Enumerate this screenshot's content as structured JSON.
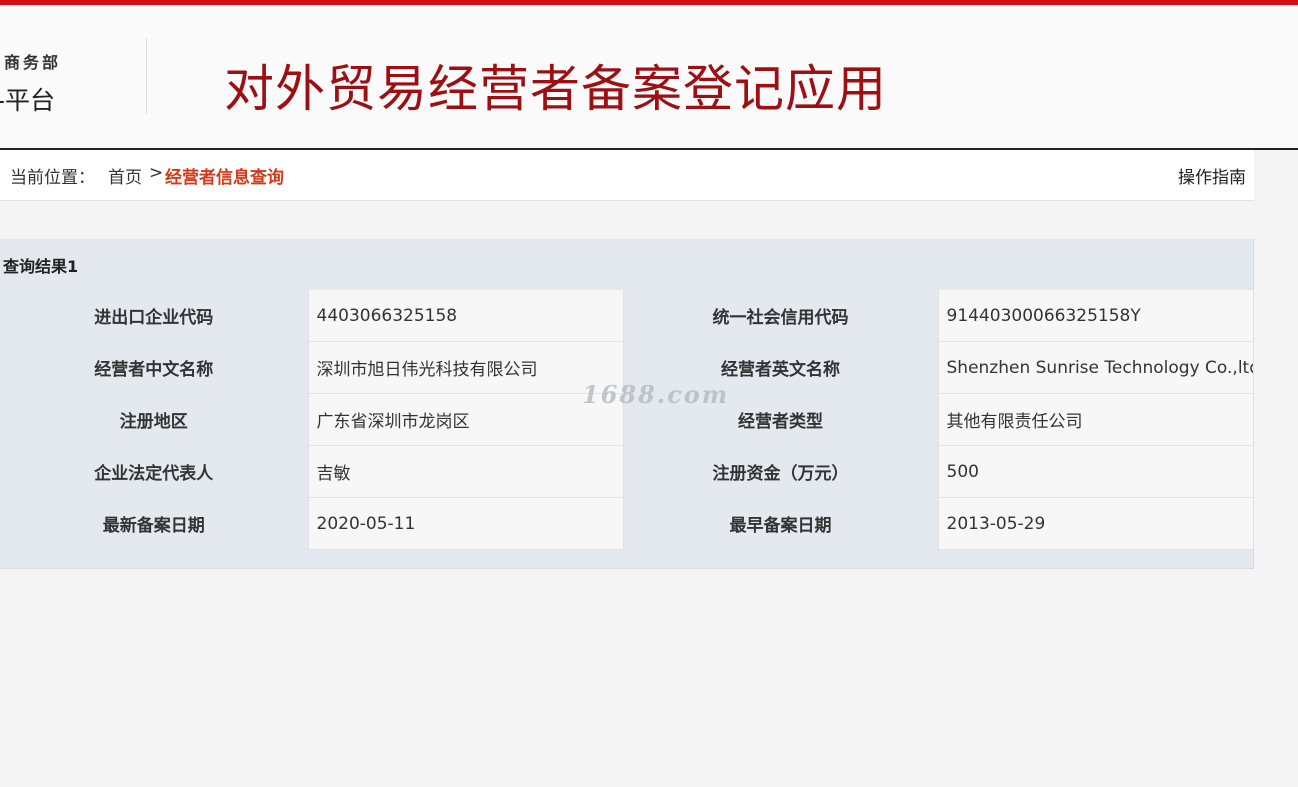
{
  "header": {
    "ministry_label": "商务部",
    "platform_label": "-平台",
    "app_title": "对外贸易经营者备案登记应用"
  },
  "breadcrumb": {
    "prefix": "当前位置：",
    "home": "首页",
    "separator": ">",
    "current": "经营者信息查询",
    "guide": "操作指南"
  },
  "result": {
    "title": "查询结果1",
    "rows": [
      {
        "label1": "进出口企业代码",
        "value1": "4403066325158",
        "label2": "统一社会信用代码",
        "value2": "914403000663251​58Y"
      },
      {
        "label1": "经营者中文名称",
        "value1": "深圳市旭日伟光科技有限公司",
        "label2": "经营者英文名称",
        "value2": "Shenzhen Sunrise Technology Co.,ltd"
      },
      {
        "label1": "注册地区",
        "value1": "广东省深圳市龙岗区",
        "label2": "经营者类型",
        "value2": "其他有限责任公司"
      },
      {
        "label1": "企业法定代表人",
        "value1": "吉敏",
        "label2": "注册资金（万元）",
        "value2": "500"
      },
      {
        "label1": "最新备案日期",
        "value1": "2020-05-11",
        "label2": "最早备案日期",
        "value2": "2013-05-29"
      }
    ]
  },
  "watermark": "1688.com"
}
